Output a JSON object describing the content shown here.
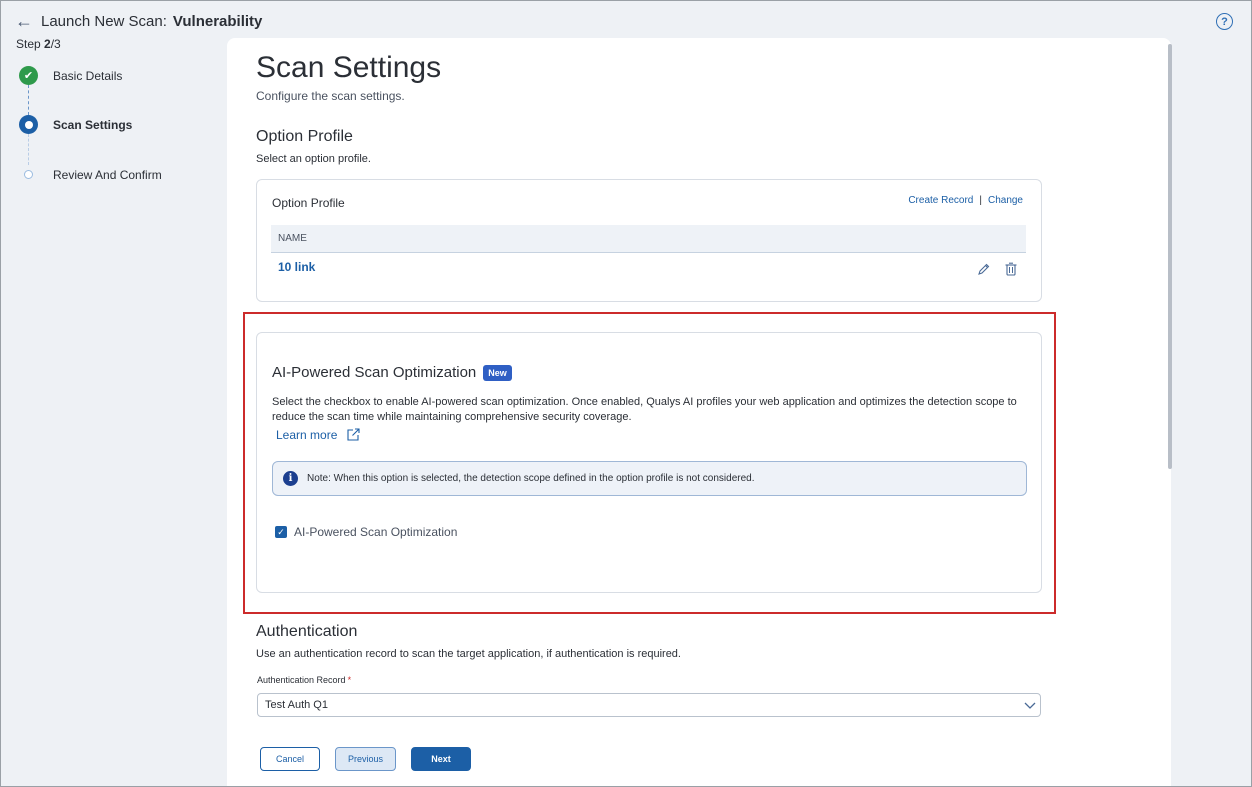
{
  "header": {
    "back_icon": "left-arrow-icon",
    "title_prefix": "Launch New Scan:",
    "title_bold": "Vulnerability",
    "help_icon": "question-circle-icon",
    "help_glyph": "?"
  },
  "step_indicator": {
    "label": "Step",
    "current": "2",
    "total": "/3"
  },
  "stepper": {
    "steps": [
      {
        "label": "Basic Details",
        "state": "done"
      },
      {
        "label": "Scan Settings",
        "state": "active"
      },
      {
        "label": "Review And Confirm",
        "state": "pending"
      }
    ]
  },
  "page": {
    "title": "Scan Settings",
    "subtitle": "Configure the scan settings."
  },
  "option_profile": {
    "section_title": "Option Profile",
    "section_desc": "Select an option profile.",
    "card_title": "Option Profile",
    "create_record": "Create Record",
    "separator": "|",
    "change": "Change",
    "table": {
      "header": "NAME",
      "rows": [
        {
          "name": "10 link"
        }
      ]
    }
  },
  "ai_optimization": {
    "title": "AI-Powered Scan Optimization",
    "badge": "New",
    "description": "Select the checkbox to enable AI-powered scan optimization. Once enabled, Qualys AI profiles your web application and optimizes the detection scope to reduce the scan time while maintaining comprehensive security coverage.",
    "learn_more": "Learn more",
    "note": "Note: When this option is selected, the detection scope defined in the option profile is not considered.",
    "checkbox_label": "AI-Powered Scan Optimization",
    "checkbox_checked": true
  },
  "authentication": {
    "section_title": "Authentication",
    "section_desc": "Use an authentication record to scan the target application, if authentication is required.",
    "field_label": "Authentication Record",
    "required_mark": "*",
    "selected_value": "Test Auth Q1"
  },
  "buttons": {
    "cancel": "Cancel",
    "previous": "Previous",
    "next": "Next"
  },
  "colors": {
    "primary": "#1c5fa6",
    "success": "#2e9a4b",
    "highlight": "#cc2b2b",
    "badge": "#2f5fc4"
  }
}
